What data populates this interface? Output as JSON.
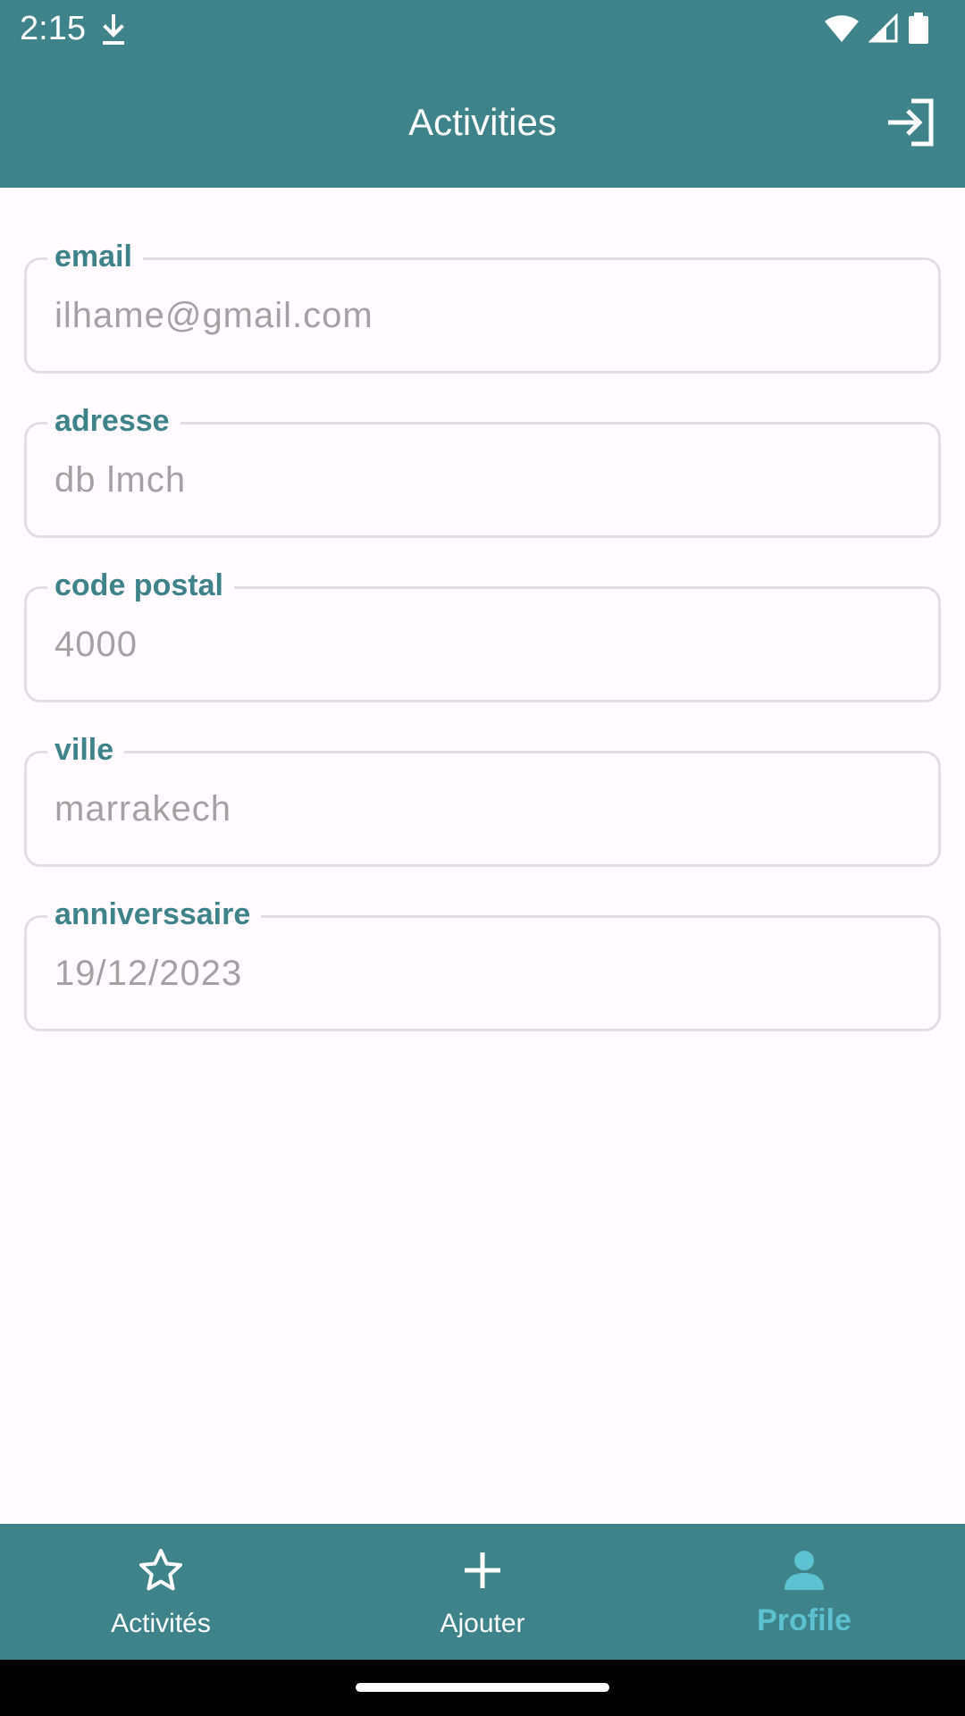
{
  "status_bar": {
    "time": "2:15",
    "icons": [
      "download-icon",
      "wifi-icon",
      "signal-icon",
      "battery-icon"
    ]
  },
  "app_bar": {
    "title": "Activities",
    "logout_icon": "logout-icon"
  },
  "form": {
    "fields": [
      {
        "label": "email",
        "value": "ilhame@gmail.com"
      },
      {
        "label": "adresse",
        "value": "db lmch"
      },
      {
        "label": "code postal",
        "value": "4000"
      },
      {
        "label": "ville",
        "value": "marrakech"
      },
      {
        "label": "anniverssaire",
        "value": "19/12/2023"
      }
    ]
  },
  "bottom_nav": {
    "items": [
      {
        "label": "Activités",
        "icon": "star-outline-icon",
        "active": false
      },
      {
        "label": "Ajouter",
        "icon": "plus-icon",
        "active": false
      },
      {
        "label": "Profile",
        "icon": "person-icon",
        "active": true
      }
    ]
  },
  "colors": {
    "primary": "#3f838a",
    "active_nav": "#5cc1d0",
    "background": "#fffbfe",
    "field_border": "#e0dcdf",
    "field_text": "#a4a1a3"
  }
}
